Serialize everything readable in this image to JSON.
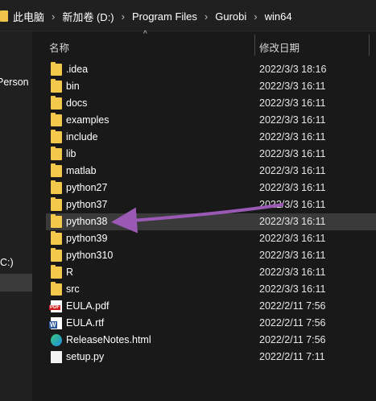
{
  "breadcrumb": [
    "此电脑",
    "新加卷 (D:)",
    "Program Files",
    "Gurobi",
    "win64"
  ],
  "nav": {
    "personal_label": "Persona",
    "drive_label": "C:)"
  },
  "columns": {
    "name": "名称",
    "date": "修改日期",
    "sort_glyph": "^"
  },
  "files": [
    {
      "name": ".idea",
      "date": "2022/3/3 18:16",
      "icon": "folder-icon",
      "type": "folder"
    },
    {
      "name": "bin",
      "date": "2022/3/3 16:11",
      "icon": "folder-icon",
      "type": "folder"
    },
    {
      "name": "docs",
      "date": "2022/3/3 16:11",
      "icon": "folder-icon",
      "type": "folder"
    },
    {
      "name": "examples",
      "date": "2022/3/3 16:11",
      "icon": "folder-icon",
      "type": "folder"
    },
    {
      "name": "include",
      "date": "2022/3/3 16:11",
      "icon": "folder-icon",
      "type": "folder"
    },
    {
      "name": "lib",
      "date": "2022/3/3 16:11",
      "icon": "folder-icon",
      "type": "folder"
    },
    {
      "name": "matlab",
      "date": "2022/3/3 16:11",
      "icon": "folder-icon",
      "type": "folder"
    },
    {
      "name": "python27",
      "date": "2022/3/3 16:11",
      "icon": "folder-icon",
      "type": "folder"
    },
    {
      "name": "python37",
      "date": "2022/3/3 16:11",
      "icon": "folder-icon",
      "type": "folder"
    },
    {
      "name": "python38",
      "date": "2022/3/3 16:11",
      "icon": "folder-icon",
      "type": "folder",
      "selected": true
    },
    {
      "name": "python39",
      "date": "2022/3/3 16:11",
      "icon": "folder-icon",
      "type": "folder"
    },
    {
      "name": "python310",
      "date": "2022/3/3 16:11",
      "icon": "folder-icon",
      "type": "folder"
    },
    {
      "name": "R",
      "date": "2022/3/3 16:11",
      "icon": "folder-icon",
      "type": "folder"
    },
    {
      "name": "src",
      "date": "2022/3/3 16:11",
      "icon": "folder-icon",
      "type": "folder"
    },
    {
      "name": "EULA.pdf",
      "date": "2022/2/11 7:56",
      "icon": "pdf-icon",
      "type": "pdf"
    },
    {
      "name": "EULA.rtf",
      "date": "2022/2/11 7:56",
      "icon": "word-icon",
      "type": "rtf"
    },
    {
      "name": "ReleaseNotes.html",
      "date": "2022/2/11 7:56",
      "icon": "edge-icon",
      "type": "edge"
    },
    {
      "name": "setup.py",
      "date": "2022/2/11 7:11",
      "icon": "python-file-icon",
      "type": "py"
    }
  ],
  "annotation": {
    "arrow_color": "#9b59b6"
  },
  "colors": {
    "folder": "#f4c94b",
    "selected_row": "#3a3a3a",
    "background": "#191919"
  }
}
